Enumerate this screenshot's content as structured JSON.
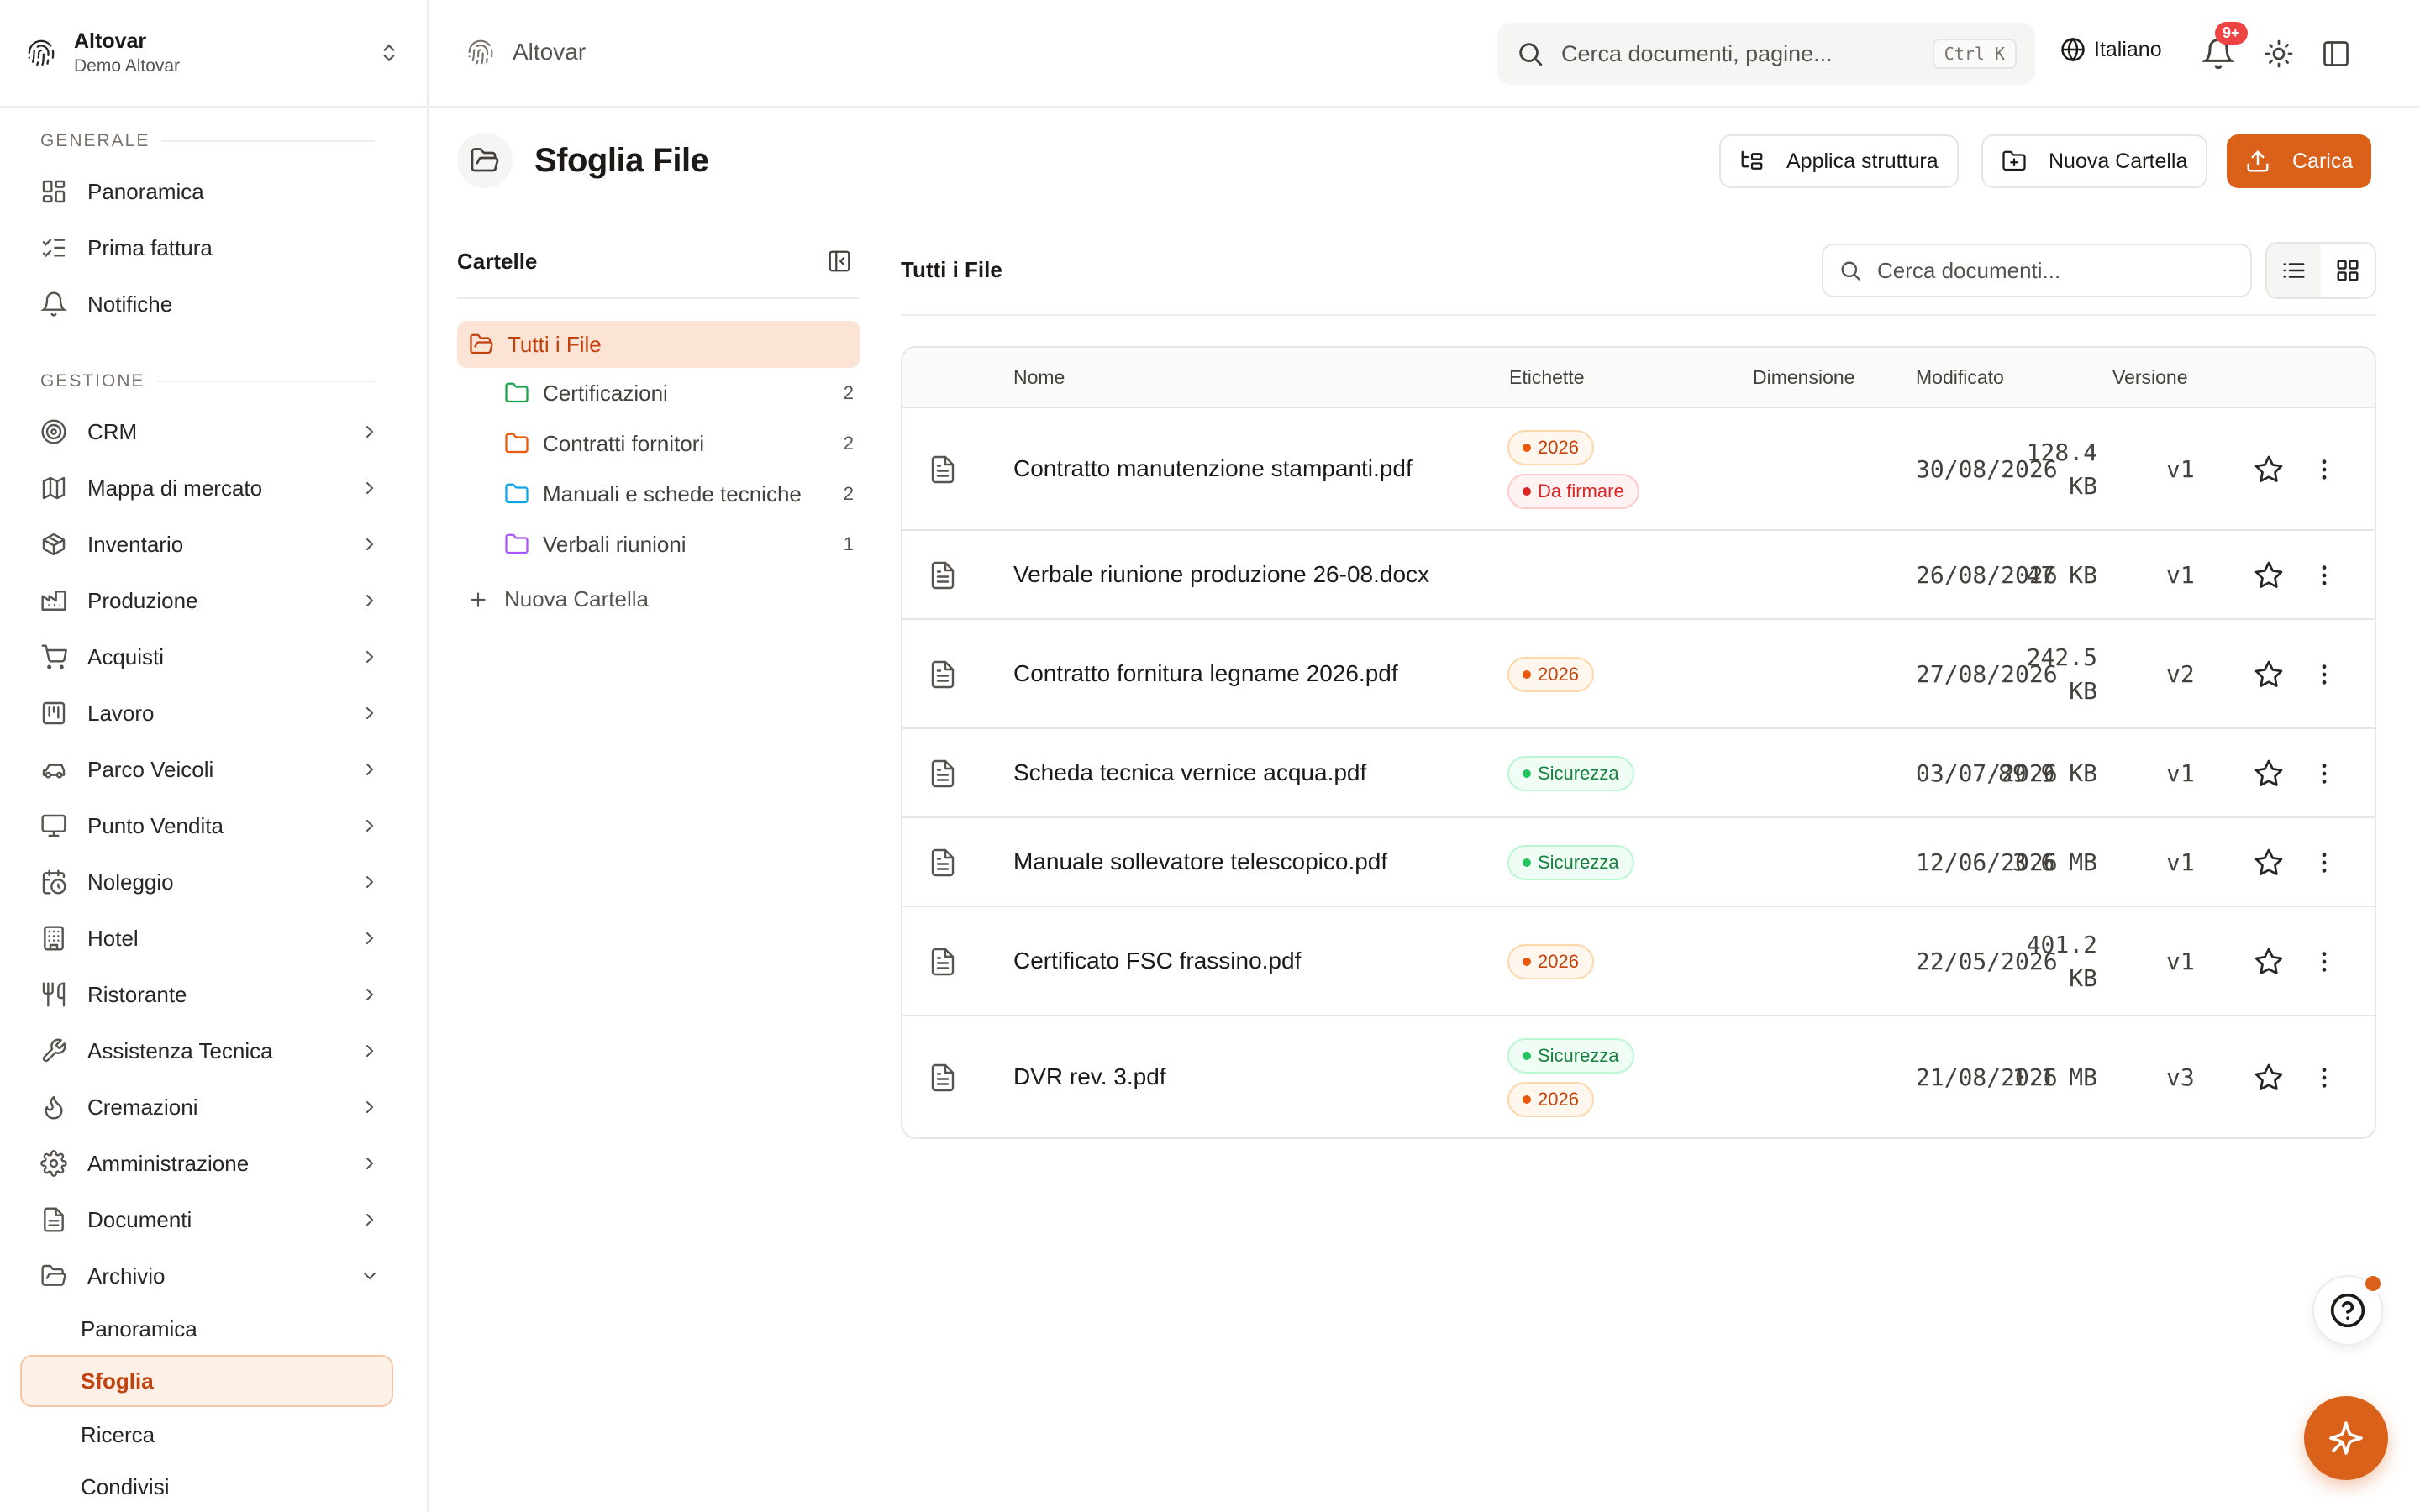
{
  "brand": {
    "name": "Altovar",
    "sub": "Demo Altovar"
  },
  "sidebar": {
    "section_general": "GENERALE",
    "section_management": "GESTIONE",
    "general_items": [
      {
        "label": "Panoramica",
        "icon": "dashboard-icon"
      },
      {
        "label": "Prima fattura",
        "icon": "checklist-icon"
      },
      {
        "label": "Notifiche",
        "icon": "bell-icon"
      }
    ],
    "management_items": [
      {
        "label": "CRM",
        "icon": "target-icon"
      },
      {
        "label": "Mappa di mercato",
        "icon": "map-icon"
      },
      {
        "label": "Inventario",
        "icon": "box-icon"
      },
      {
        "label": "Produzione",
        "icon": "factory-icon"
      },
      {
        "label": "Acquisti",
        "icon": "cart-icon"
      },
      {
        "label": "Lavoro",
        "icon": "kanban-icon"
      },
      {
        "label": "Parco Veicoli",
        "icon": "car-icon"
      },
      {
        "label": "Punto Vendita",
        "icon": "monitor-icon"
      },
      {
        "label": "Noleggio",
        "icon": "calendar-clock-icon"
      },
      {
        "label": "Hotel",
        "icon": "building-icon"
      },
      {
        "label": "Ristorante",
        "icon": "utensils-icon"
      },
      {
        "label": "Assistenza Tecnica",
        "icon": "wrench-icon"
      },
      {
        "label": "Cremazioni",
        "icon": "flame-icon"
      },
      {
        "label": "Amministrazione",
        "icon": "gear-icon"
      },
      {
        "label": "Documenti",
        "icon": "document-icon"
      },
      {
        "label": "Archivio",
        "icon": "folder-open-icon"
      }
    ],
    "archive_sub": [
      "Panoramica",
      "Sfoglia",
      "Ricerca",
      "Condivisi"
    ]
  },
  "topbar": {
    "breadcrumb": "Altovar",
    "search_placeholder": "Cerca documenti, pagine...",
    "shortcut": "Ctrl K",
    "language": "Italiano",
    "notif_badge": "9+"
  },
  "page": {
    "title": "Sfoglia File",
    "btn_structure": "Applica struttura",
    "btn_new_folder": "Nuova Cartella",
    "btn_upload": "Carica"
  },
  "folders": {
    "title": "Cartelle",
    "all": "Tutti i File",
    "items": [
      {
        "label": "Certificazioni",
        "count": "2",
        "color": "#16a34a"
      },
      {
        "label": "Contratti fornitori",
        "count": "2",
        "color": "#ea580c"
      },
      {
        "label": "Manuali e schede tecniche",
        "count": "2",
        "color": "#0ea5e9"
      },
      {
        "label": "Verbali riunioni",
        "count": "1",
        "color": "#a855f7"
      }
    ],
    "new": "Nuova Cartella"
  },
  "files": {
    "title": "Tutti i File",
    "search_placeholder": "Cerca documenti...",
    "columns": {
      "name": "Nome",
      "tags": "Etichette",
      "size": "Dimensione",
      "modified": "Modificato",
      "version": "Versione"
    },
    "rows": [
      {
        "name": "Contratto manutenzione stampanti.pdf",
        "tags": [
          "2026",
          "Da firmare"
        ],
        "size": [
          "128.4",
          "KB"
        ],
        "modified": "30/08/2026",
        "version": "v1"
      },
      {
        "name": "Verbale riunione produzione 26-08.docx",
        "tags": [],
        "size": [
          "47 KB"
        ],
        "modified": "26/08/2026",
        "version": "v1"
      },
      {
        "name": "Contratto fornitura legname 2026.pdf",
        "tags": [
          "2026"
        ],
        "size": [
          "242.5",
          "KB"
        ],
        "modified": "27/08/2026",
        "version": "v2"
      },
      {
        "name": "Scheda tecnica vernice acqua.pdf",
        "tags": [
          "Sicurezza"
        ],
        "size": [
          "89.9 KB"
        ],
        "modified": "03/07/2026",
        "version": "v1"
      },
      {
        "name": "Manuale sollevatore telescopico.pdf",
        "tags": [
          "Sicurezza"
        ],
        "size": [
          "3.6 MB"
        ],
        "modified": "12/06/2026",
        "version": "v1"
      },
      {
        "name": "Certificato FSC frassino.pdf",
        "tags": [
          "2026"
        ],
        "size": [
          "401.2",
          "KB"
        ],
        "modified": "22/05/2026",
        "version": "v1"
      },
      {
        "name": "DVR rev. 3.pdf",
        "tags": [
          "Sicurezza",
          "2026"
        ],
        "size": [
          "1.1 MB"
        ],
        "modified": "21/08/2026",
        "version": "v3"
      }
    ]
  },
  "tag_colors": {
    "2026": {
      "fg": "#c2410c",
      "dot": "#ea580c",
      "bg": "#fff7ed",
      "border": "#fed7aa"
    },
    "Da firmare": {
      "fg": "#dc2626",
      "dot": "#dc2626",
      "bg": "#fef2f2",
      "border": "#fecaca"
    },
    "Sicurezza": {
      "fg": "#15803d",
      "dot": "#22c55e",
      "bg": "#f0fdf4",
      "border": "#bbf7d0"
    }
  },
  "accent": "#d9611a"
}
